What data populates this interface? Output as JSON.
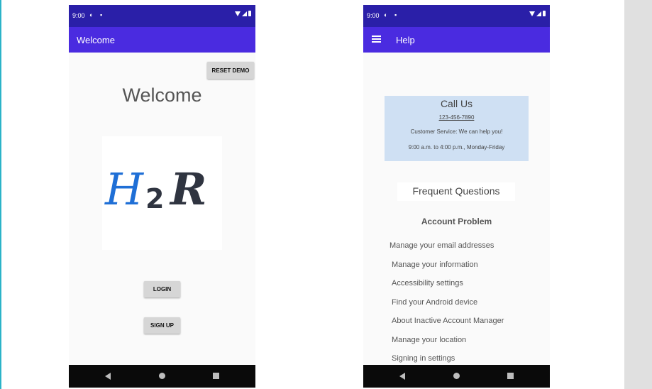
{
  "status": {
    "time": "9:00"
  },
  "welcome_screen": {
    "appbar_title": "Welcome",
    "reset_label": "RESET DEMO",
    "heading": "Welcome",
    "logo": {
      "h": "H",
      "two": "2",
      "r": "R"
    },
    "login_label": "LOGIN",
    "signup_label": "SIGN UP"
  },
  "help_screen": {
    "appbar_title": "Help",
    "call_us": {
      "title": "Call Us",
      "phone": "123-456-7890",
      "service": "Customer Service: We can help you!",
      "hours": "9:00 a.m. to 4:00 p.m., Monday-Friday"
    },
    "faq_title": "Frequent Questions",
    "section": "Account Problem",
    "items": [
      "Manage your email addresses",
      "Manage your information",
      "Accessibility settings",
      "Find your Android device",
      "About Inactive Account Manager",
      "Manage your location",
      "Signing in settings"
    ]
  },
  "colors": {
    "status_bar": "#2a1fa8",
    "app_bar": "#4a2be0",
    "call_box": "#cfe0f3",
    "logo_blue": "#1f6fd6",
    "logo_dark": "#2f3440"
  },
  "icons": [
    "wifi-icon",
    "signal-icon",
    "battery-icon",
    "menu-icon",
    "back-icon",
    "home-icon",
    "recents-icon"
  ]
}
